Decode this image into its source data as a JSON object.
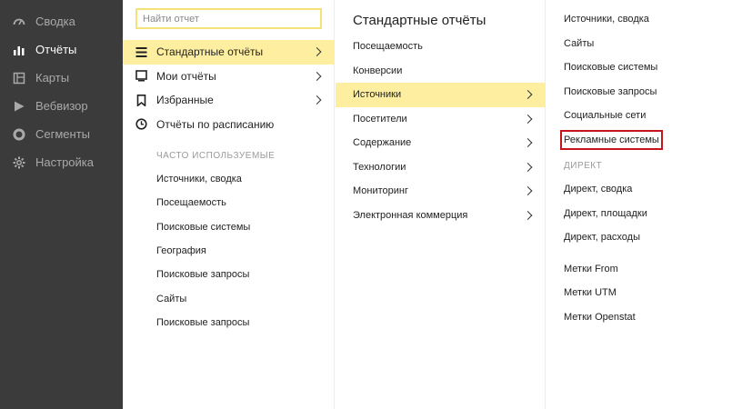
{
  "sidebar": {
    "items": [
      {
        "label": "Сводка",
        "icon": "dashboard-icon",
        "active": false
      },
      {
        "label": "Отчёты",
        "icon": "bar-chart-icon",
        "active": true
      },
      {
        "label": "Карты",
        "icon": "map-icon",
        "active": false
      },
      {
        "label": "Вебвизор",
        "icon": "play-icon",
        "active": false
      },
      {
        "label": "Сегменты",
        "icon": "segments-icon",
        "active": false
      },
      {
        "label": "Настройка",
        "icon": "gear-icon",
        "active": false
      }
    ]
  },
  "reports_menu": {
    "search_placeholder": "Найти отчет",
    "items": [
      {
        "label": "Стандартные отчёты",
        "icon": "list-icon",
        "active": true,
        "has_submenu": true
      },
      {
        "label": "Мои отчёты",
        "icon": "monitor-icon",
        "active": false,
        "has_submenu": true
      },
      {
        "label": "Избранные",
        "icon": "bookmark-icon",
        "active": false,
        "has_submenu": true
      },
      {
        "label": "Отчёты по расписанию",
        "icon": "clock-icon",
        "active": false,
        "has_submenu": false
      }
    ],
    "frequent_heading": "ЧАСТО ИСПОЛЬЗУЕМЫЕ",
    "frequent_items": [
      "Источники, сводка",
      "Посещаемость",
      "Поисковые системы",
      "География",
      "Поисковые запросы",
      "Сайты",
      "Поисковые запросы"
    ]
  },
  "standard_reports": {
    "title": "Стандартные отчёты",
    "items": [
      {
        "label": "Посещаемость",
        "has_submenu": false,
        "active": false
      },
      {
        "label": "Конверсии",
        "has_submenu": false,
        "active": false
      },
      {
        "label": "Источники",
        "has_submenu": true,
        "active": true
      },
      {
        "label": "Посетители",
        "has_submenu": true,
        "active": false
      },
      {
        "label": "Содержание",
        "has_submenu": true,
        "active": false
      },
      {
        "label": "Технологии",
        "has_submenu": true,
        "active": false
      },
      {
        "label": "Мониторинг",
        "has_submenu": true,
        "active": false
      },
      {
        "label": "Электронная коммерция",
        "has_submenu": true,
        "active": false
      }
    ]
  },
  "sources": {
    "items": [
      "Источники, сводка",
      "Сайты",
      "Поисковые системы",
      "Поисковые запросы",
      "Социальные сети",
      "Рекламные системы"
    ],
    "highlighted_item": "Рекламные системы",
    "highlight_color": "#c4161c",
    "direct_heading": "ДИРЕКТ",
    "direct_items": [
      "Директ, сводка",
      "Директ, площадки",
      "Директ, расходы"
    ],
    "tag_items": [
      "Метки From",
      "Метки UTM",
      "Метки Openstat"
    ]
  },
  "colors": {
    "sidebar_bg": "#3b3b3b",
    "active_bg": "#fdeea0",
    "search_border": "#f7e27a"
  }
}
